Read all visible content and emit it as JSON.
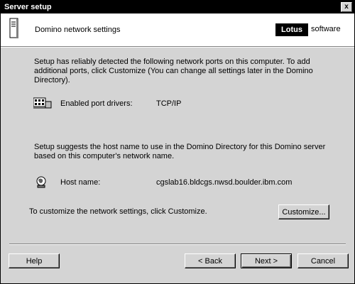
{
  "window": {
    "title": "Server setup",
    "close_glyph": "x"
  },
  "header": {
    "title": "Domino network settings",
    "logo_bold": "Lotus",
    "logo_word": "software"
  },
  "main": {
    "intro": "Setup has reliably detected the following network ports on this computer. To add additional ports, click Customize (You can change all settings later in the Domino Directory).",
    "ports_label": "Enabled port drivers:",
    "ports_value": "TCP/IP",
    "host_intro": "Setup suggests the host name to use in the Domino Directory for this Domino server based on this computer's network name.",
    "host_label": "Host name:",
    "host_value": "cgslab16.bldcgs.nwsd.boulder.ibm.com",
    "customize_text": "To customize the network settings, click Customize.",
    "customize_button": "Customize..."
  },
  "footer": {
    "help_label": "Help",
    "back_label": "< Back",
    "next_label": "Next >",
    "cancel_label": "Cancel"
  },
  "icons": [
    "server-icon",
    "network-ports-icon",
    "host-globe-icon",
    "close-icon"
  ]
}
